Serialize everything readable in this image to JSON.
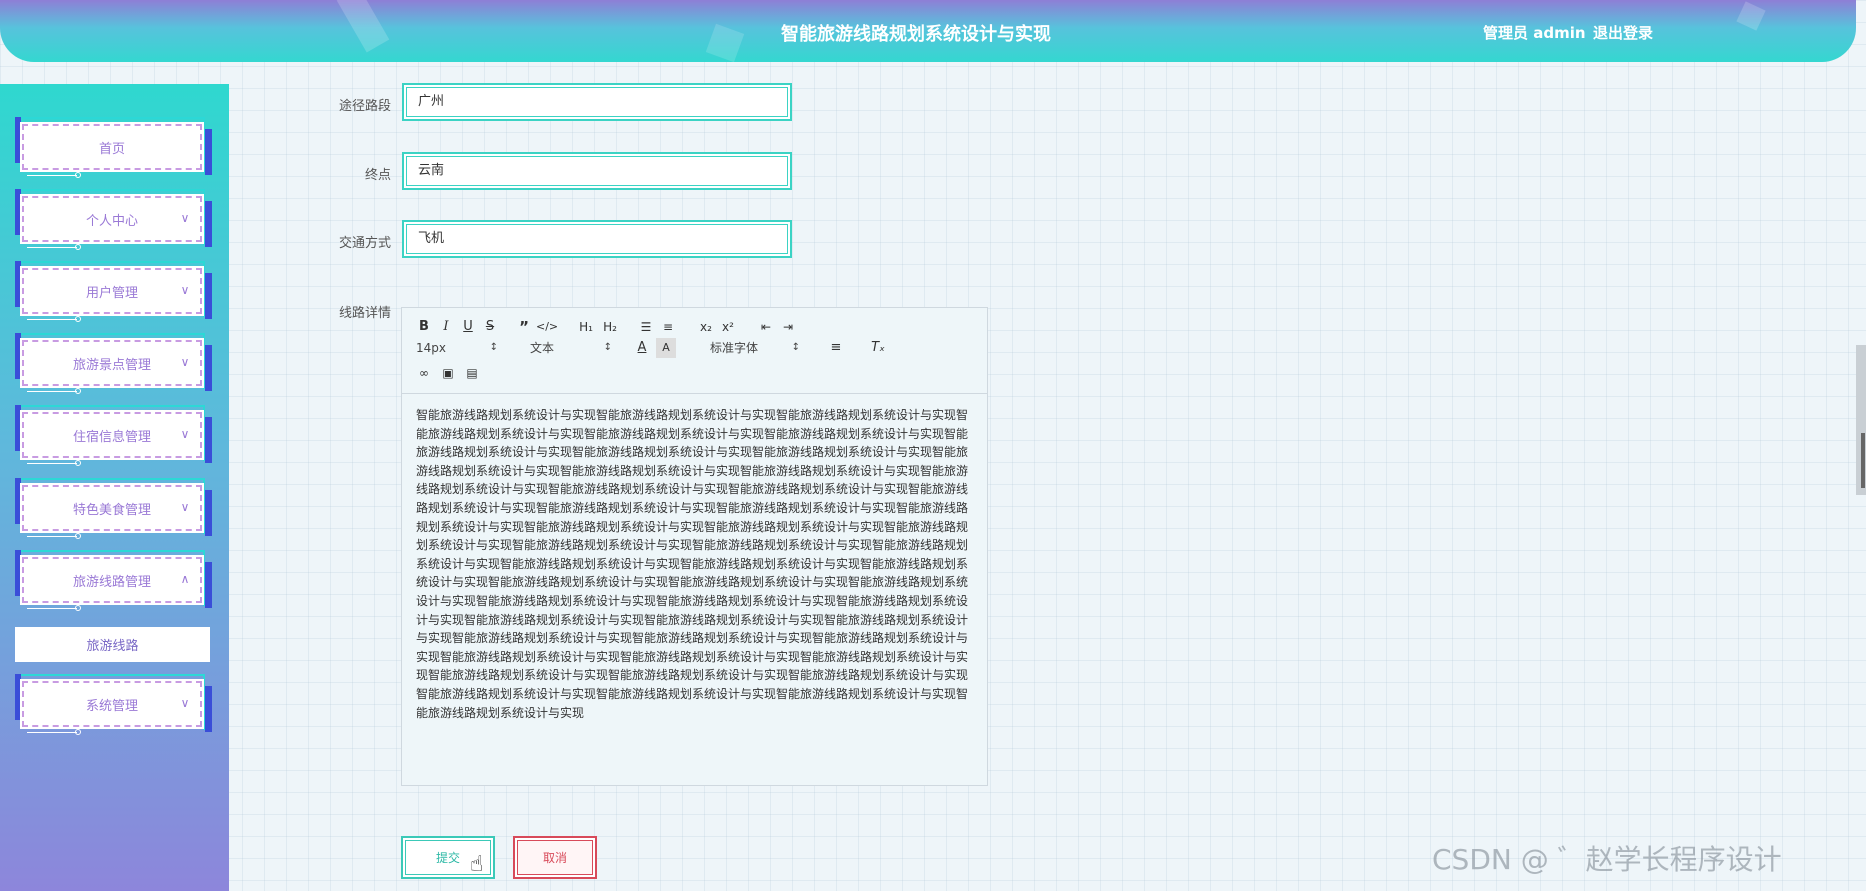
{
  "header": {
    "title": "智能旅游线路规划系统设计与实现",
    "user": "管理员 admin",
    "logout": "退出登录"
  },
  "sidebar": {
    "items": [
      {
        "label": "首页"
      },
      {
        "label": "个人中心"
      },
      {
        "label": "用户管理"
      },
      {
        "label": "旅游景点管理"
      },
      {
        "label": "住宿信息管理"
      },
      {
        "label": "特色美食管理"
      },
      {
        "label": "旅游线路管理"
      },
      {
        "label": "系统管理"
      }
    ],
    "submenu": {
      "label": "旅游线路"
    }
  },
  "form": {
    "route_label": "途径路段",
    "route_value": "广州",
    "dest_label": "终点",
    "dest_value": "云南",
    "transport_label": "交通方式",
    "transport_value": "飞机",
    "detail_label": "线路详情"
  },
  "editor": {
    "font_size": "14px",
    "text_type": "文本",
    "font_family": "标准字体",
    "content": "智能旅游线路规划系统设计与实现智能旅游线路规划系统设计与实现智能旅游线路规划系统设计与实现智能旅游线路规划系统设计与实现智能旅游线路规划系统设计与实现智能旅游线路规划系统设计与实现智能旅游线路规划系统设计与实现智能旅游线路规划系统设计与实现智能旅游线路规划系统设计与实现智能旅游线路规划系统设计与实现智能旅游线路规划系统设计与实现智能旅游线路规划系统设计与实现智能旅游线路规划系统设计与实现智能旅游线路规划系统设计与实现智能旅游线路规划系统设计与实现智能旅游线路规划系统设计与实现智能旅游线路规划系统设计与实现智能旅游线路规划系统设计与实现智能旅游线路规划系统设计与实现智能旅游线路规划系统设计与实现智能旅游线路规划系统设计与实现智能旅游线路规划系统设计与实现智能旅游线路规划系统设计与实现智能旅游线路规划系统设计与实现智能旅游线路规划系统设计与实现智能旅游线路规划系统设计与实现智能旅游线路规划系统设计与实现智能旅游线路规划系统设计与实现智能旅游线路规划系统设计与实现智能旅游线路规划系统设计与实现智能旅游线路规划系统设计与实现智能旅游线路规划系统设计与实现智能旅游线路规划系统设计与实现智能旅游线路规划系统设计与实现智能旅游线路规划系统设计与实现智能旅游线路规划系统设计与实现智能旅游线路规划系统设计与实现智能旅游线路规划系统设计与实现智能旅游线路规划系统设计与实现智能旅游线路规划系统设计与实现智能旅游线路规划系统设计与实现智能旅游线路规划系统设计与实现智能旅游线路规划系统设计与实现智能旅游线路规划系统设计与实现智能旅游线路规划系统设计与实现智能旅游线路规划系统设计与实现智能旅游线路规划系统设计与实现智能旅游线路规划系统设计与实现智能旅游线路规划系统设计与实现智能旅游线路规划系统设计与实现"
  },
  "buttons": {
    "submit": "提交",
    "cancel": "取消"
  },
  "watermark": "CSDN @ ゛赵学长程序设计",
  "colors": {
    "accent": "#3bd3c4",
    "menu_text": "#9a79d6",
    "cancel": "#d84a5a"
  }
}
